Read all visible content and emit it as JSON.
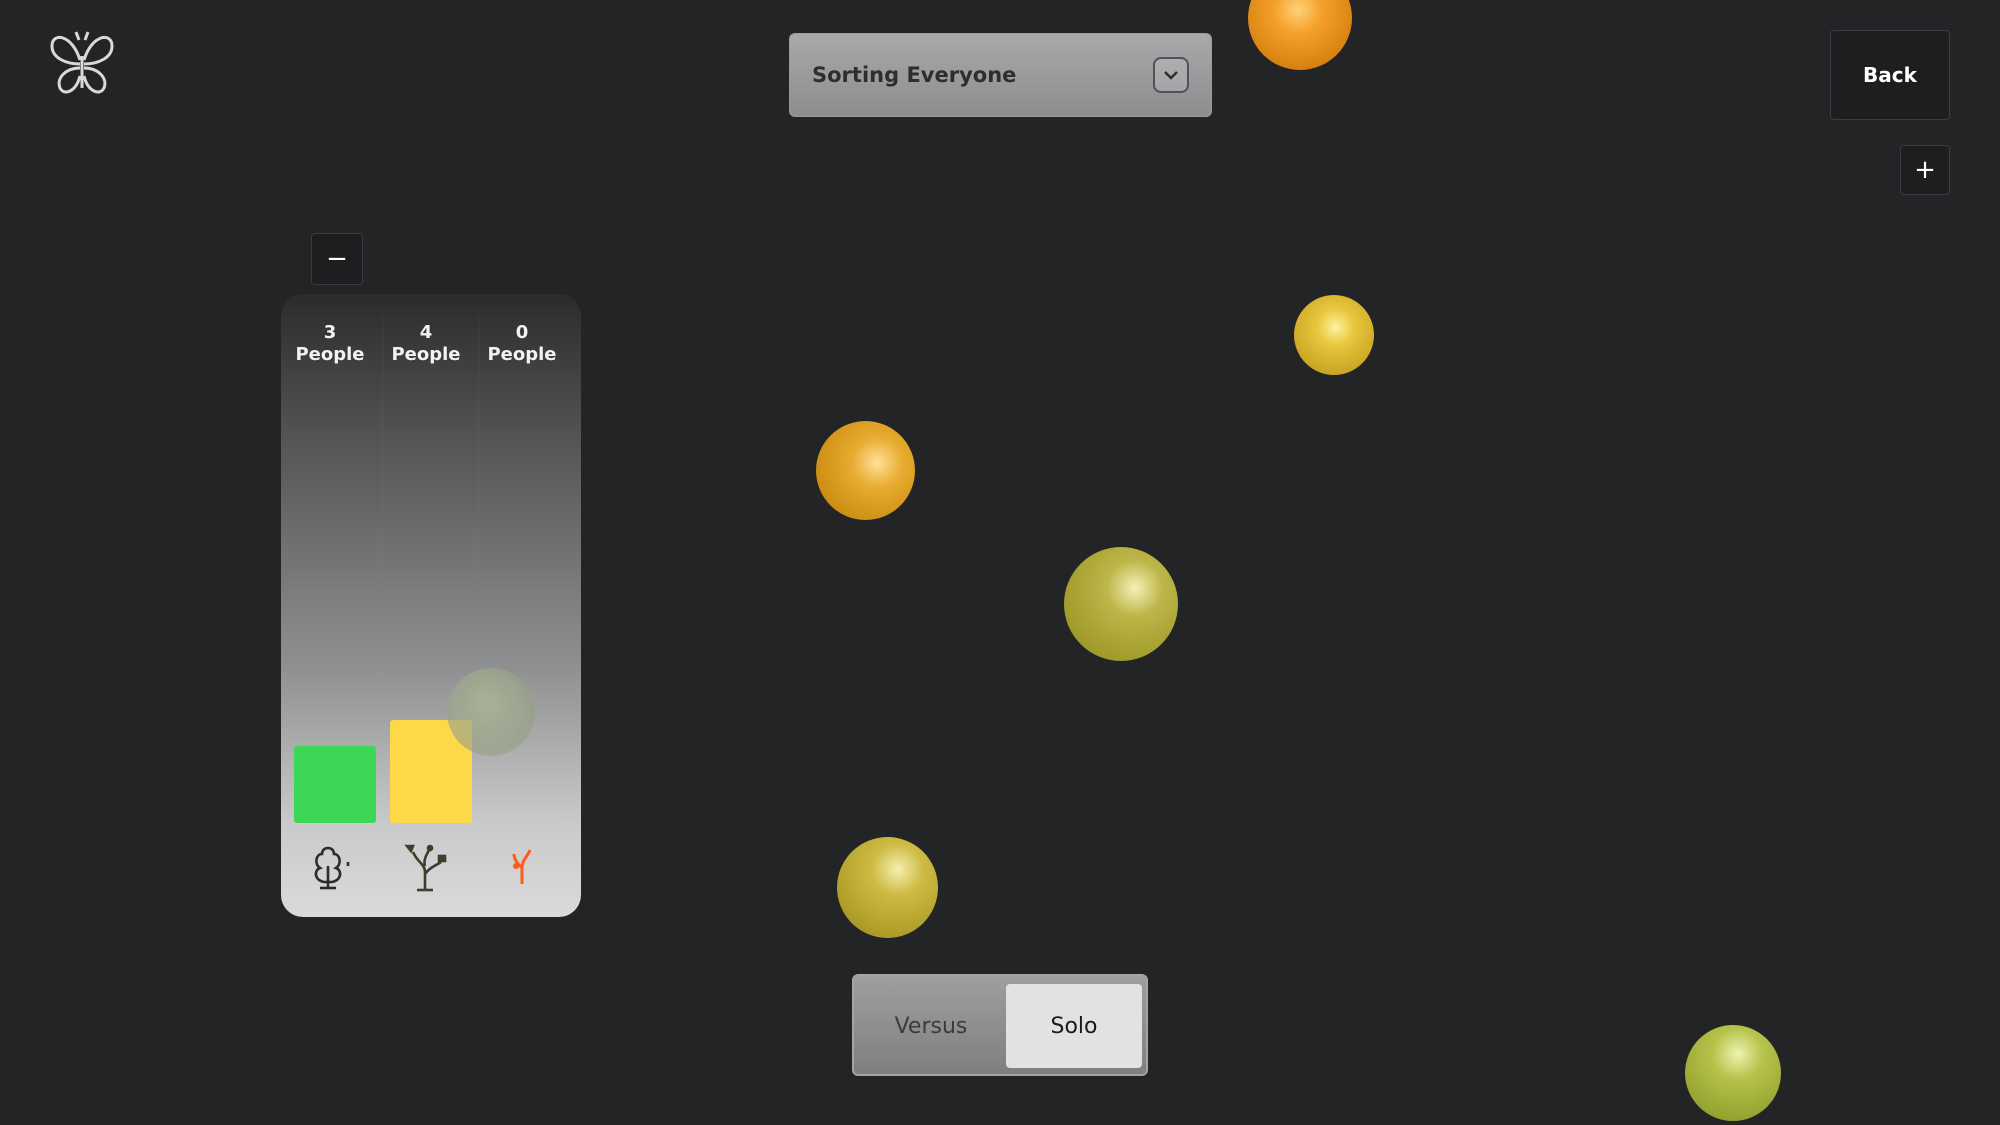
{
  "header": {
    "logo_icon": "butterfly-icon",
    "dropdown": {
      "selected": "Sorting Everyone",
      "icon": "chevron-down-icon"
    },
    "back_label": "Back",
    "plus_label": "+"
  },
  "panel": {
    "minus_label": "−",
    "columns": [
      {
        "count": "3",
        "unit": "People",
        "value": 3,
        "color": "#3ed657",
        "icon": "tree-icon",
        "icon_color": "#2b2b2b"
      },
      {
        "count": "4",
        "unit": "People",
        "value": 4,
        "color": "#fdd94a",
        "icon": "sprouting-branch-icon",
        "icon_color": "#3c3f2a"
      },
      {
        "count": "0",
        "unit": "People",
        "value": 0,
        "color": "#c8c8c8",
        "icon": "coral-icon",
        "icon_color": "#ff5a1e"
      }
    ]
  },
  "mode_toggle": {
    "options": [
      "Versus",
      "Solo"
    ],
    "selected": "Solo"
  },
  "balls": [
    {
      "color": "orange"
    },
    {
      "color": "yellow"
    },
    {
      "color": "amber"
    },
    {
      "color": "olive"
    },
    {
      "color": "yellow-olive"
    },
    {
      "color": "lime-olive"
    }
  ],
  "colors": {
    "background": "#222426",
    "green_bar": "#3ed657",
    "yellow_bar": "#fdd94a",
    "accent_orange": "#ff5a1e"
  }
}
